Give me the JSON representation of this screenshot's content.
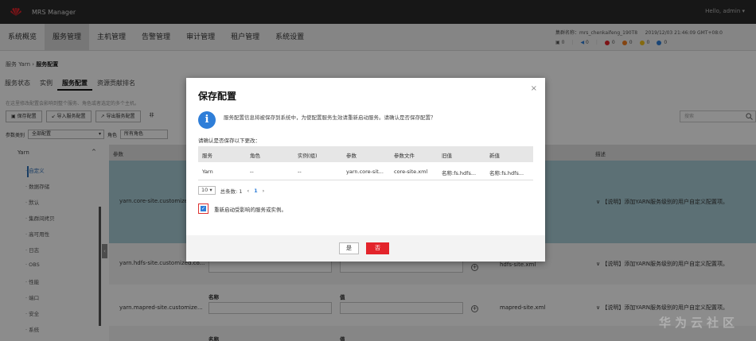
{
  "app": {
    "title": "MRS Manager",
    "user": "Hello, admin ▾",
    "accent": "#2f7ed8",
    "danger": "#e3242b"
  },
  "nav": {
    "tabs": [
      {
        "label": "系统概览"
      },
      {
        "label": "服务管理"
      },
      {
        "label": "主机管理"
      },
      {
        "label": "告警管理"
      },
      {
        "label": "审计管理"
      },
      {
        "label": "租户管理"
      },
      {
        "label": "系统设置"
      }
    ],
    "cluster_name": "集群名称：mrs_chenkaifeng_190T8",
    "datetime": "2019/12/03 21:46:09 GMT+08:0",
    "stats": {
      "tasks": "0",
      "info": "0",
      "critical": "0",
      "major": "0",
      "minor": "0",
      "warning": "0"
    }
  },
  "breadcrumb": {
    "parent": "服务 Yarn  ›",
    "current": "服务配置"
  },
  "subtabs": [
    "服务状态",
    "实例",
    "服务配置",
    "资源贡献排名"
  ],
  "hint": "在这里修改配置会影响到整个服务、角色或者选定的多个主机。",
  "toolbar": {
    "save": "保存配置",
    "import": "导入服务配置",
    "export": "导出服务配置",
    "more": "非"
  },
  "search": {
    "placeholder": "搜索"
  },
  "filter": {
    "label": "参数类别",
    "value": "全部配置",
    "role_label": "角色",
    "role_value": "所有角色"
  },
  "tree": {
    "root": "Yarn",
    "items": [
      "自定义",
      "数据存储",
      "默认",
      "集群间拷贝",
      "高可用性",
      "日志",
      "OBS",
      "性能",
      "端口",
      "安全",
      "系统"
    ]
  },
  "table": {
    "headers": {
      "param": "参数",
      "desc": "描述"
    },
    "name_label": "名称",
    "value_label": "值",
    "rows": [
      {
        "param": "yarn.core-site.customized...",
        "file": "",
        "desc": "【说明】添加YARN服务级别的用户自定义配置项。"
      },
      {
        "param": "yarn.hdfs-site.customized.co...",
        "file": "hdfs-site.xml",
        "desc": "【说明】添加YARN服务级别的用户自定义配置项。"
      },
      {
        "param": "yarn.mapred-site.customize...",
        "file": "mapred-site.xml",
        "desc": "【说明】添加YARN服务级别的用户自定义配置项。"
      }
    ]
  },
  "dialog": {
    "title": "保存配置",
    "message": "服务配置信息将被保存到系统中，为使配置服务生效请重新启动服务。请确认是否保存配置？",
    "confirm_label": "请确认是否保存以下更改：",
    "columns": [
      "服务",
      "角色",
      "实例(组)",
      "参数",
      "参数文件",
      "旧值",
      "新值"
    ],
    "row": [
      "Yarn",
      "--",
      "--",
      "yarn.core-sit...",
      "core-site.xml",
      "名称:fs.hdfs...",
      "名称:fs.hdfs..."
    ],
    "pager": {
      "size": "10 ▾",
      "total": "总条数: 1",
      "page": "1"
    },
    "restart_label": "重新启动受影响的服务或实例。",
    "yes": "是",
    "no": "否"
  },
  "watermark": "华为云社区"
}
